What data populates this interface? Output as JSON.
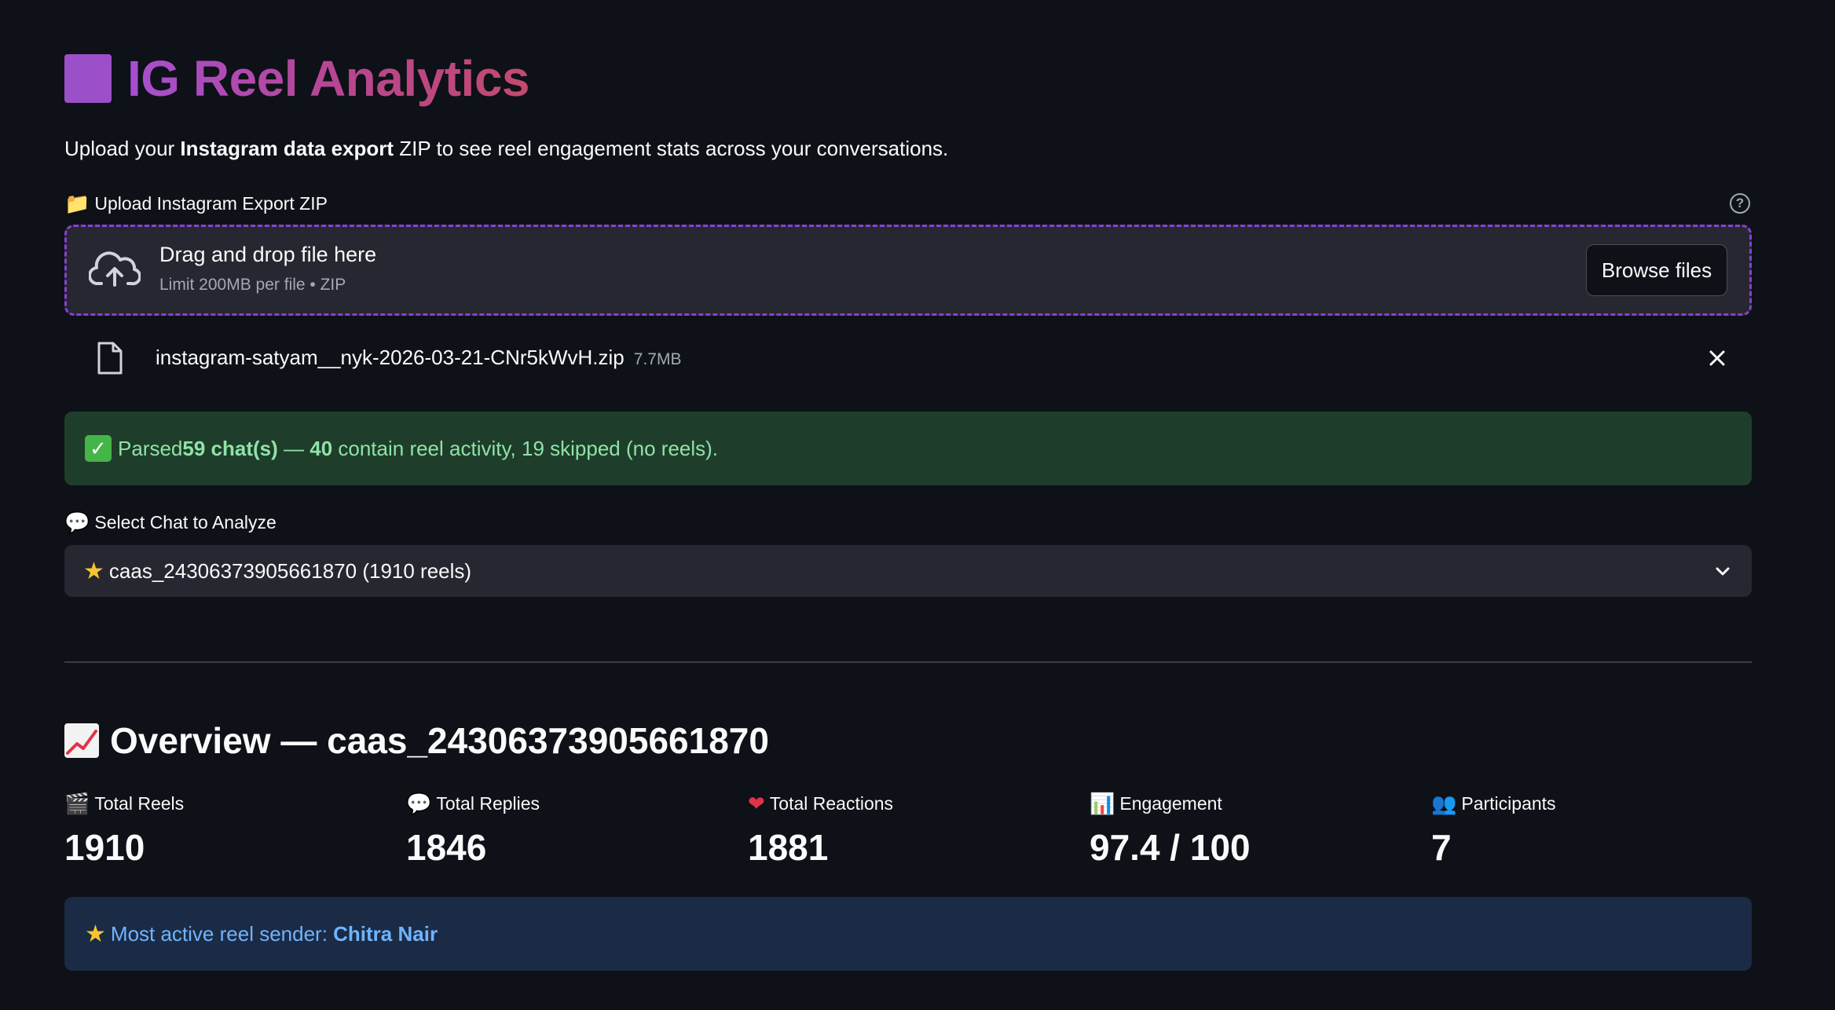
{
  "header": {
    "title": "IG Reel Analytics",
    "intro_prefix": "Upload your ",
    "intro_bold": "Instagram data export",
    "intro_suffix": " ZIP to see reel engagement stats across your conversations."
  },
  "uploader": {
    "label_emoji": "📁",
    "label": "Upload Instagram Export ZIP",
    "help_icon": "?",
    "drop_title": "Drag and drop file here",
    "drop_sub": "Limit 200MB per file • ZIP",
    "browse_label": "Browse files",
    "file_name": "instagram-satyam__nyk-2026-03-21-CNr5kWvH.zip",
    "file_size": "7.7MB"
  },
  "success": {
    "check": "✓",
    "t1": "Parsed ",
    "b1": "59 chat(s)",
    "t2": " — ",
    "b2": "40",
    "t3": " contain reel activity, 19 skipped (no reels)."
  },
  "select": {
    "label_emoji": "💬",
    "label": "Select Chat to Analyze",
    "value_star": "★",
    "value": "caas_24306373905661870 (1910 reels)"
  },
  "overview": {
    "title": "Overview — caas_24306373905661870"
  },
  "metrics": [
    {
      "emoji": "🎬",
      "label": "Total Reels",
      "value": "1910"
    },
    {
      "emoji": "💬",
      "label": "Total Replies",
      "value": "1846"
    },
    {
      "emoji": "❤",
      "label": "Total Reactions",
      "value": "1881"
    },
    {
      "emoji": "📊",
      "label": "Engagement",
      "value": "97.4 / 100"
    },
    {
      "emoji": "👥",
      "label": "Participants",
      "value": "7"
    }
  ],
  "info": {
    "star": "★",
    "text": "Most active reel sender: ",
    "name": "Chitra Nair"
  },
  "colors": {
    "background": "#0e1117",
    "accent_purple": "#8a3fd6",
    "success_bg": "#1f3d2b",
    "info_bg": "#1b2b45"
  }
}
